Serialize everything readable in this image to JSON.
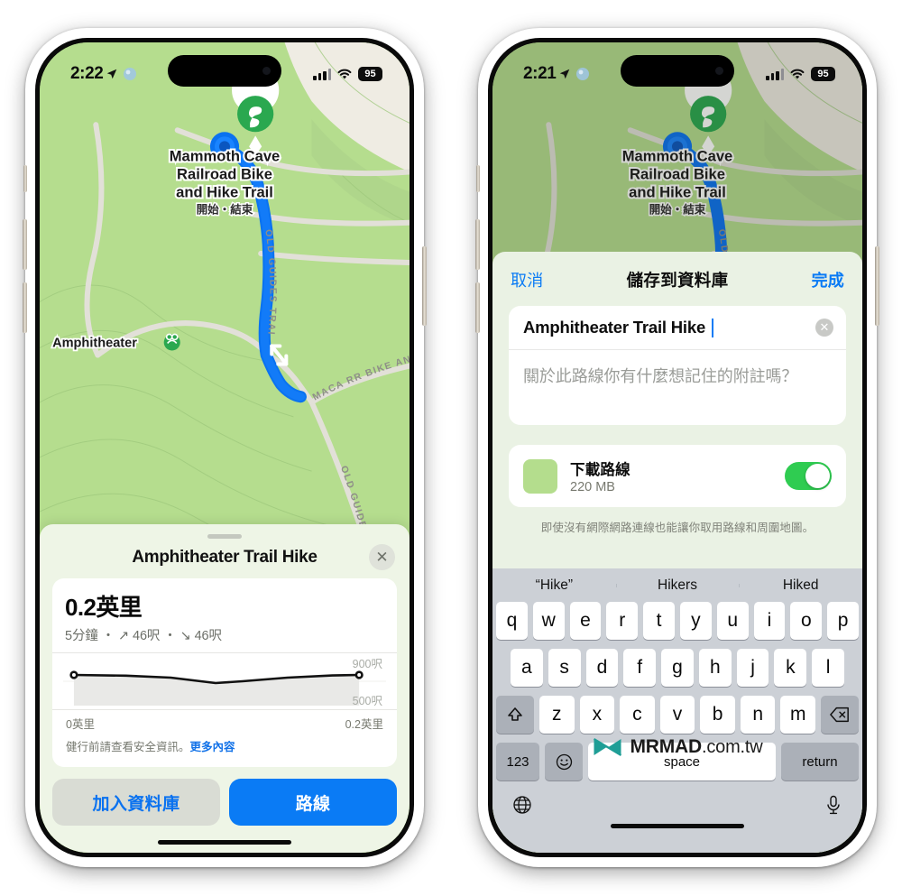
{
  "left_phone": {
    "status": {
      "time": "2:22",
      "location_icon": "location-arrow-icon",
      "signal": "signal-bars-icon",
      "wifi": "wifi-icon",
      "battery": "95"
    },
    "map": {
      "pin_icon": "hike-trail-pin-icon",
      "start_marker": "route-start-dot",
      "trail_title": "Mammoth Cave\nRailroad Bike\nand Hike Trail",
      "trail_title_lines": [
        "Mammoth Cave",
        "Railroad Bike",
        "and Hike Trail"
      ],
      "trail_subtitle": "開始・結束",
      "labels": {
        "amphitheater": "Amphitheater",
        "maca": "MACA RR BIKE AND H",
        "old_guides": "OLD GUIDES TRAIL",
        "old_guides_2": "OLD GUIDES T"
      }
    },
    "sheet": {
      "title": "Amphitheater Trail Hike",
      "close_icon": "close-icon",
      "distance": "0.2英里",
      "summary": "5分鐘 ・ ↗ 46呎 ・ ↘ 46呎",
      "y_high": "900呎",
      "y_low": "500呎",
      "x_start": "0英里",
      "x_end": "0.2英里",
      "safety_text": "健行前請查看安全資訊。",
      "safety_link": "更多內容",
      "button_secondary": "加入資料庫",
      "button_primary": "路線"
    }
  },
  "right_phone": {
    "status": {
      "time": "2:21",
      "location_icon": "location-arrow-icon",
      "signal": "signal-bars-icon",
      "wifi": "wifi-icon",
      "battery": "95"
    },
    "modal": {
      "cancel": "取消",
      "title": "儲存到資料庫",
      "done": "完成",
      "name_value": "Amphitheater Trail Hike",
      "clear_icon": "clear-text-icon",
      "note_placeholder": "關於此路線你有什麼想記住的附註嗎？",
      "download_title": "下載路線",
      "download_size": "220 MB",
      "download_thumb": "route-thumbnail",
      "toggle_state": "on",
      "footer": "即使沒有網際網路連線也能讓你取用路線和周圍地圖。"
    },
    "keyboard": {
      "suggestions": [
        "“Hike”",
        "Hikers",
        "Hiked"
      ],
      "row1": [
        "q",
        "w",
        "e",
        "r",
        "t",
        "y",
        "u",
        "i",
        "o",
        "p"
      ],
      "row2": [
        "a",
        "s",
        "d",
        "f",
        "g",
        "h",
        "j",
        "k",
        "l"
      ],
      "row3_shift": "shift-icon",
      "row3": [
        "z",
        "x",
        "c",
        "v",
        "b",
        "n",
        "m"
      ],
      "row3_backspace": "backspace-icon",
      "numbers_key": "123",
      "emoji_key": "emoji-icon",
      "space_key": "space",
      "return_key": "return",
      "globe_icon": "globe-icon",
      "mic_icon": "microphone-icon"
    }
  },
  "watermark": {
    "brand": "MRMAD",
    "suffix": ".com.tw",
    "logo": "mrmad-bowtie-logo"
  },
  "colors": {
    "map_green": "#b5dd8e",
    "map_green_dim": "#8fb873",
    "trail_blue": "#0a72f0",
    "accent_blue": "#0a7bf5",
    "toggle_green": "#2fcc51",
    "sheet_bg": "#eef5e6",
    "modal_bg": "#eaf2e4",
    "keyboard_bg": "#ccd0d6",
    "watermark_teal": "#1f9e96"
  }
}
